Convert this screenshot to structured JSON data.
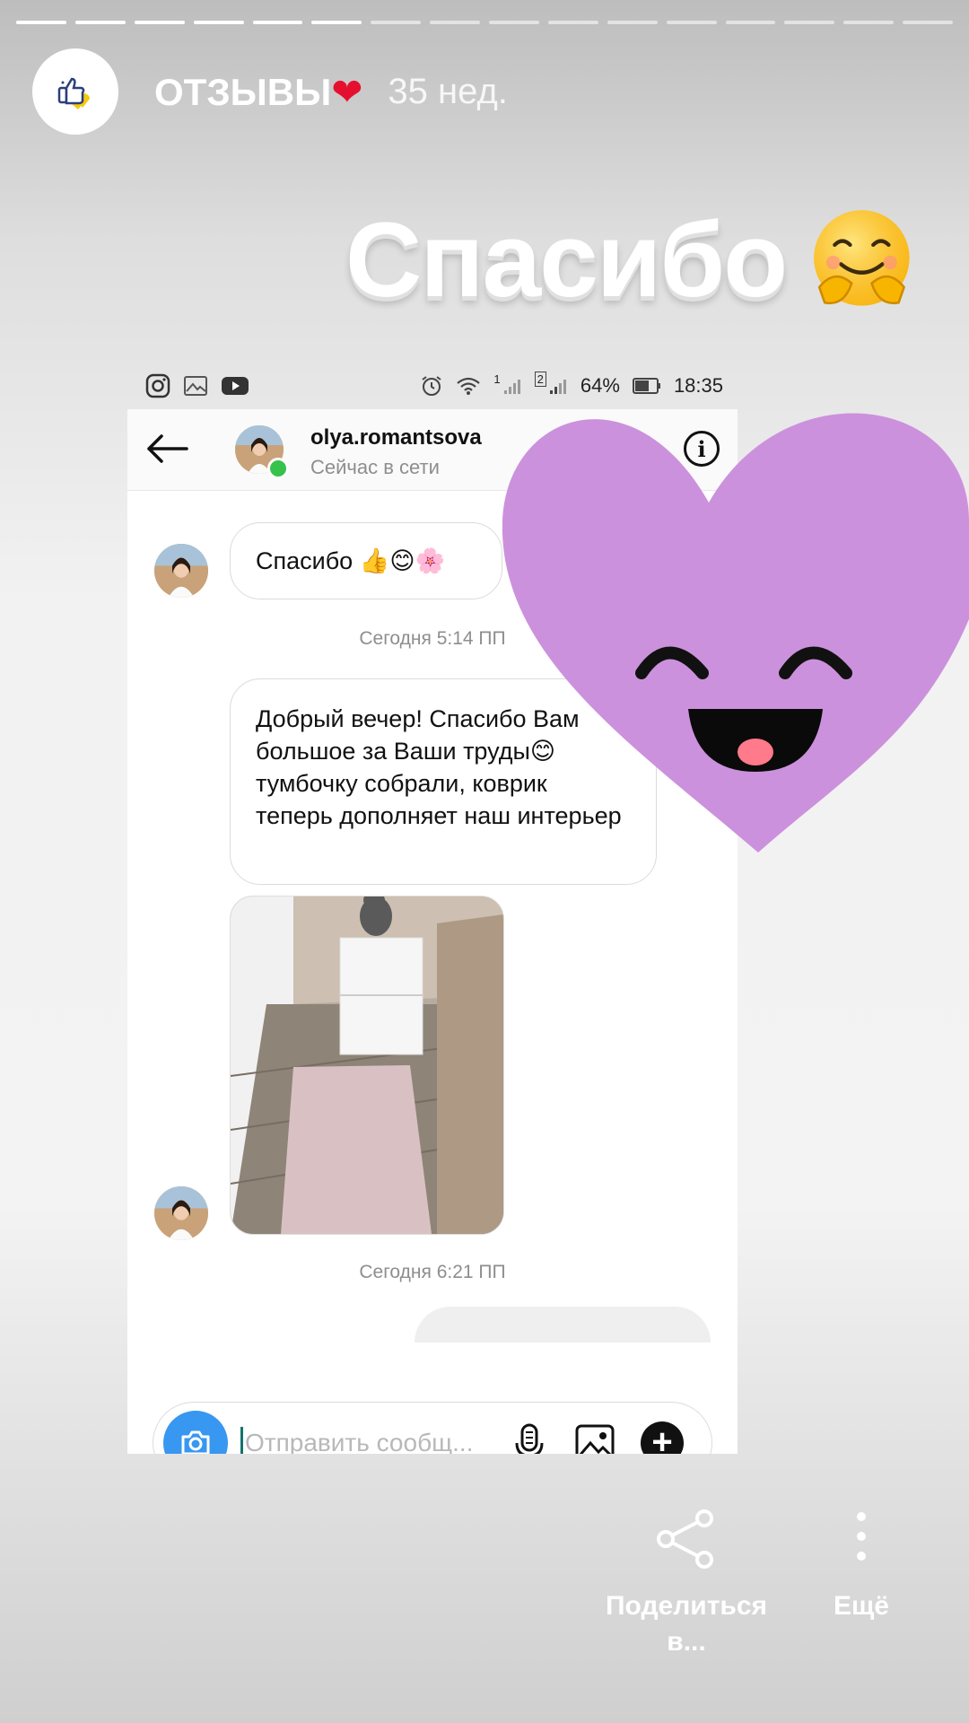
{
  "story": {
    "progress": {
      "total": 16,
      "current": 6
    },
    "title": "ОТЗЫВЫ",
    "title_heart": "❤",
    "age": "35 нед.",
    "banner_text": "Спасибо",
    "banner_emoji": "🤗"
  },
  "status_bar": {
    "battery": "64%",
    "time": "18:35",
    "sim1": "1",
    "sim2": "2"
  },
  "chat": {
    "contact_name": "olya.romantsova",
    "contact_status": "Сейчас в сети",
    "messages": {
      "m1": "Спасибо 👍😊🌸",
      "ts1": "Сегодня 5:14 ПП",
      "m2": "Добрый вечер! Спасибо Вам большое за Ваши труды😊 тумбочку собрали, коврик теперь дополняет наш интерьер",
      "ts2": "Сегодня 6:21 ПП"
    },
    "composer_placeholder": "Отправить сообщ..."
  },
  "actions": {
    "share_label": "Поделиться в...",
    "more_label": "Ещё"
  },
  "colors": {
    "accent_blue": "#3897f0",
    "heart_purple": "#cc91dd",
    "online_green": "#36c24b"
  },
  "icons": [
    "thumbs-up-heart-icon",
    "instagram-icon",
    "gallery-icon",
    "youtube-icon",
    "alarm-icon",
    "wifi-icon",
    "signal-icon",
    "battery-icon",
    "back-arrow-icon",
    "info-icon",
    "camera-icon",
    "mic-icon",
    "image-icon",
    "plus-icon",
    "share-icon",
    "more-vertical-icon"
  ]
}
